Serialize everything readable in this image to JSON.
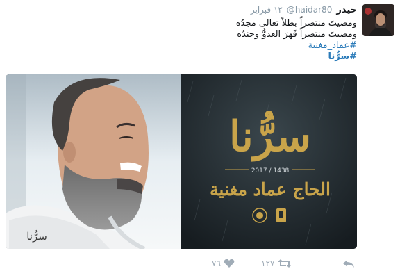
{
  "tweet": {
    "display_name": "حيدر",
    "handle": "@haidar80",
    "timestamp": "١٢ فبراير",
    "lines": [
      "ومضيتَ منتصراً بطلاً تعالى مجدُه",
      "ومضيتَ منتصراً قَهرَ العدوُّ وجندُه"
    ],
    "hashtags": [
      "#عماد_مغنية",
      "#سرُّنا"
    ]
  },
  "media": {
    "year_hijri": "1438",
    "year_gregorian": "2017",
    "year_line": "1438 / 2017",
    "title": "سرُّنا",
    "subtitle": "الحاج عماد مغنية",
    "signature": "سرُّنا"
  },
  "actions": {
    "retweet_count": "١٢٧",
    "like_count": "٧٦"
  },
  "colors": {
    "accent": "#2b7bb9",
    "gold": "#c9a44a",
    "icon": "#a0acb7"
  }
}
